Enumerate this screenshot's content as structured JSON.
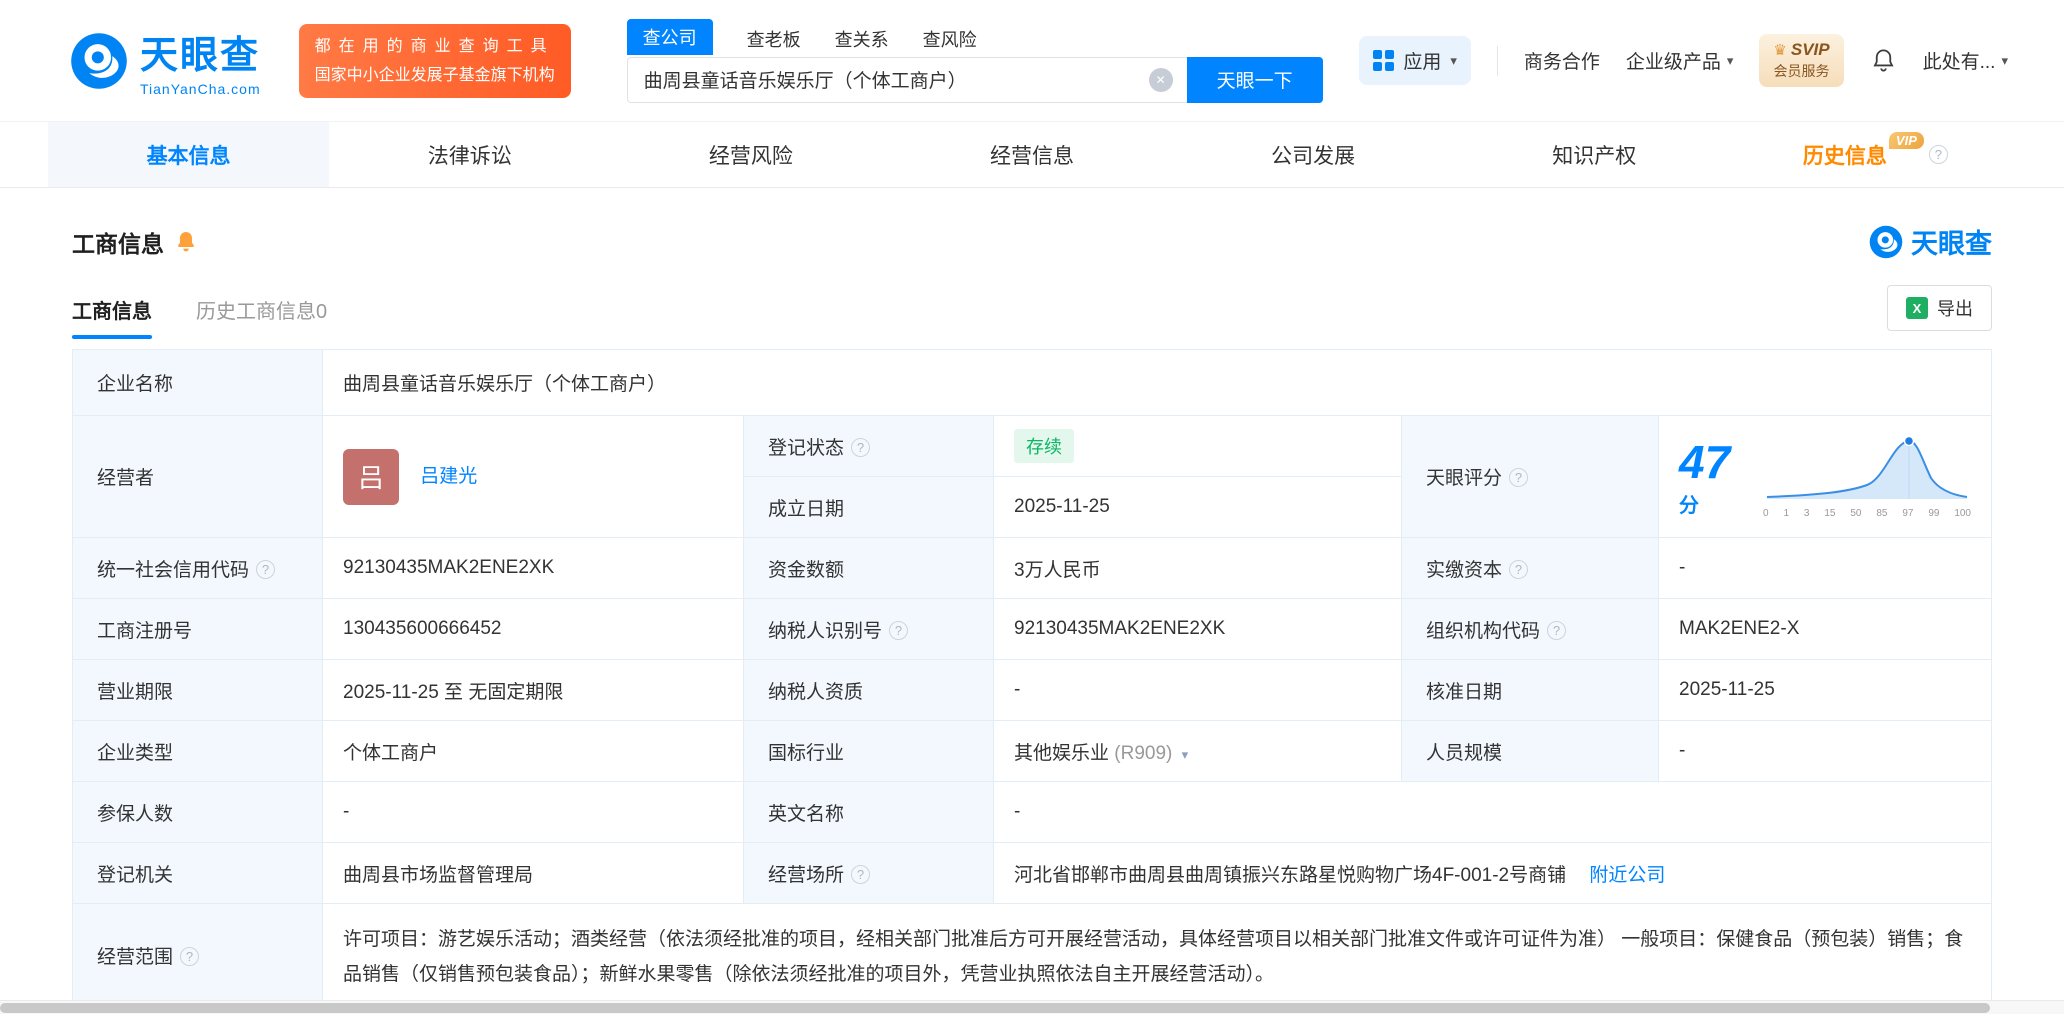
{
  "header": {
    "logo": {
      "brand": "天眼查",
      "domain": "TianYanCha.com"
    },
    "promo": {
      "line1": "都在用的商业查询工具",
      "line2": "国家中小企业发展子基金旗下机构"
    },
    "search": {
      "tabs": [
        {
          "label": "查公司",
          "active": true
        },
        {
          "label": "查老板",
          "active": false
        },
        {
          "label": "查关系",
          "active": false
        },
        {
          "label": "查风险",
          "active": false
        }
      ],
      "value": "曲周县童话音乐娱乐厅（个体工商户）",
      "submit_label": "天眼一下"
    },
    "actions": {
      "apps_label": "应用",
      "cooperation_label": "商务合作",
      "enterprise_label": "企业级产品",
      "svip_line1": "SVIP",
      "svip_line2": "会员服务",
      "more_label": "此处有..."
    }
  },
  "nav": {
    "tabs": [
      {
        "label": "基本信息",
        "active": true
      },
      {
        "label": "法律诉讼"
      },
      {
        "label": "经营风险"
      },
      {
        "label": "经营信息"
      },
      {
        "label": "公司发展"
      },
      {
        "label": "知识产权"
      },
      {
        "label": "历史信息",
        "vip": "VIP"
      }
    ]
  },
  "section": {
    "title": "工商信息",
    "brand_watermark": "天眼查",
    "sub_tabs": [
      {
        "label": "工商信息",
        "active": true
      },
      {
        "label": "历史工商信息0",
        "active": false
      }
    ],
    "export_label": "导出"
  },
  "table": {
    "company_name": {
      "label": "企业名称",
      "value": "曲周县童话音乐娱乐厅（个体工商户）"
    },
    "operator": {
      "label": "经营者",
      "avatar": "吕",
      "name": "吕建光"
    },
    "reg_status": {
      "label": "登记状态",
      "value": "存续"
    },
    "establish_date": {
      "label": "成立日期",
      "value": "2025-11-25"
    },
    "score": {
      "label": "天眼评分",
      "value": "47",
      "unit": "分",
      "axis": [
        "0",
        "1",
        "3",
        "15",
        "50",
        "85",
        "97",
        "99",
        "100"
      ]
    },
    "credit_code": {
      "label": "统一社会信用代码",
      "value": "92130435MAK2ENE2XK"
    },
    "capital": {
      "label": "资金数额",
      "value": "3万人民币"
    },
    "paid_capital": {
      "label": "实缴资本",
      "value": "-"
    },
    "reg_number": {
      "label": "工商注册号",
      "value": "130435600666452"
    },
    "taxpayer_id": {
      "label": "纳税人识别号",
      "value": "92130435MAK2ENE2XK"
    },
    "org_code": {
      "label": "组织机构代码",
      "value": "MAK2ENE2-X"
    },
    "business_term": {
      "label": "营业期限",
      "value": "2025-11-25 至 无固定期限"
    },
    "taxpayer_quality": {
      "label": "纳税人资质",
      "value": "-"
    },
    "approval_date": {
      "label": "核准日期",
      "value": "2025-11-25"
    },
    "company_type": {
      "label": "企业类型",
      "value": "个体工商户"
    },
    "industry": {
      "label": "国标行业",
      "value": "其他娱乐业",
      "code": "(R909)"
    },
    "staff_size": {
      "label": "人员规模",
      "value": "-"
    },
    "insured_count": {
      "label": "参保人数",
      "value": "-"
    },
    "english_name": {
      "label": "英文名称",
      "value": "-"
    },
    "reg_authority": {
      "label": "登记机关",
      "value": "曲周县市场监督管理局"
    },
    "premises": {
      "label": "经营场所",
      "value": "河北省邯郸市曲周县曲周镇振兴东路星悦购物广场4F-001-2号商铺",
      "link": "附近公司"
    },
    "business_scope": {
      "label": "经营范围",
      "value": "许可项目：游艺娱乐活动；酒类经营（依法须经批准的项目，经相关部门批准后方可开展经营活动，具体经营项目以相关部门批准文件或许可证件为准） 一般项目：保健食品（预包装）销售；食品销售（仅销售预包装食品）；新鲜水果零售（除依法须经批准的项目外，凭营业执照依法自主开展经营活动）。"
    }
  },
  "icons": {
    "caret_down": "▾",
    "clear": "✕",
    "help": "?",
    "crown": "♛",
    "excel_x": "X"
  },
  "colors": {
    "primary": "#0084ff",
    "orange_tab": "#ff8a00",
    "promo_orange": "#ff5b25",
    "status_green_text": "#0bb664",
    "status_green_bg": "#e3f7ec",
    "label_cell_bg": "#f2f8fe",
    "table_border": "#e3edf6",
    "avatar_bg": "#c4706d"
  }
}
